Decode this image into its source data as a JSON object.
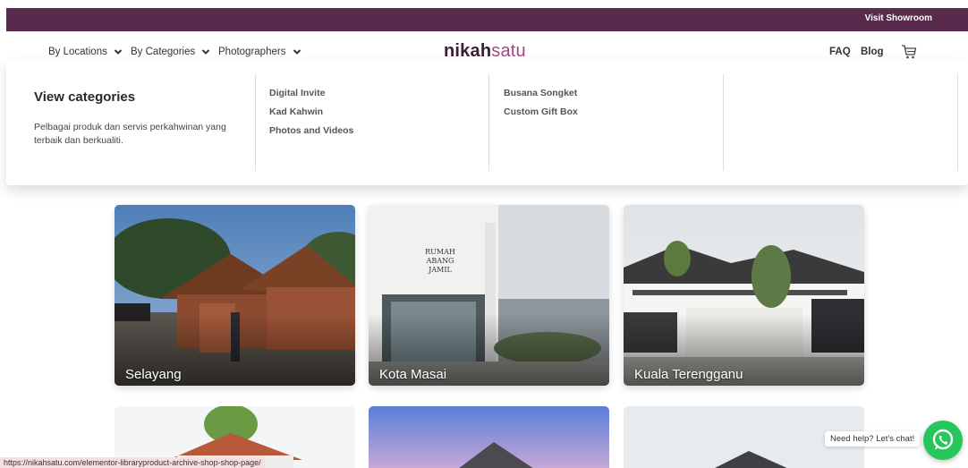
{
  "topbar": {
    "link": "Visit Showroom"
  },
  "nav": {
    "left": [
      "By Locations",
      "By Categories",
      "Photographers"
    ],
    "logo_part1": "nikah",
    "logo_part2": "satu",
    "right": [
      "FAQ",
      "Blog"
    ]
  },
  "mega_menu": {
    "title": "View categories",
    "description": "Pelbagai produk dan servis perkahwinan yang terbaik dan berkualiti.",
    "column1": [
      "Digital Invite",
      "Kad Kahwin",
      "Photos and Videos"
    ],
    "column2": [
      "Busana Songket",
      "Custom Gift Box"
    ]
  },
  "locations": [
    {
      "name": "Selayang"
    },
    {
      "name": "Kota Masai"
    },
    {
      "name": "Kuala Terengganu"
    }
  ],
  "status_url": "https://nikahsatu.com/elementor-libraryproduct-archive-shop-shop-page/",
  "chat": {
    "tooltip": "Need help? Let's chat!"
  },
  "colors": {
    "brand_dark": "#5a2a4c",
    "brand_accent": "#a24785",
    "whatsapp": "#25c65a"
  }
}
